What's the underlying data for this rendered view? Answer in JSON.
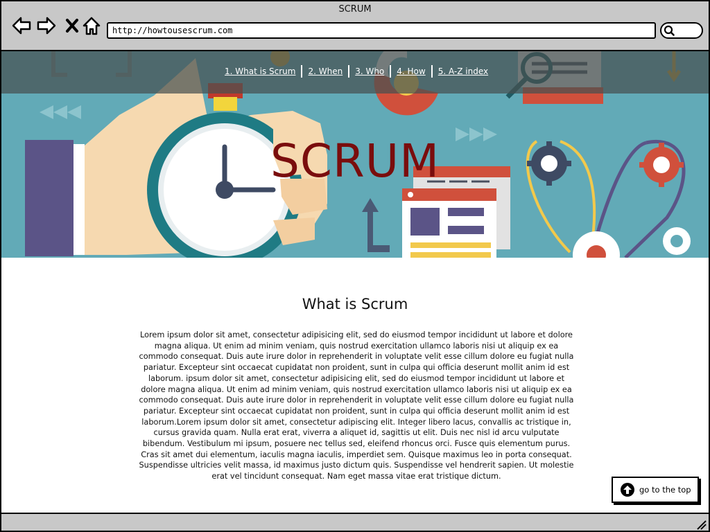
{
  "browser": {
    "window_title": "SCRUM",
    "url": "http://howtousescrum.com",
    "icons": {
      "back": "back-arrow-icon",
      "forward": "forward-arrow-icon",
      "stop": "close-icon",
      "home": "home-icon",
      "search": "search-icon",
      "resize": "resize-grip-icon"
    }
  },
  "nav": {
    "items": [
      {
        "label": "1. What is Scrum"
      },
      {
        "label": "2. When"
      },
      {
        "label": "3. Who"
      },
      {
        "label": "4. How"
      },
      {
        "label": "5. A-Z index"
      }
    ]
  },
  "hero": {
    "title": "SCRUM",
    "colors": {
      "background": "#62aab7",
      "title": "#7a0d0d",
      "overlay": "#465050"
    }
  },
  "content": {
    "heading": "What is Scrum",
    "body": "Lorem ipsum dolor sit amet, consectetur adipisicing elit, sed do eiusmod tempor incididunt ut labore et dolore magna aliqua. Ut enim ad minim veniam, quis nostrud exercitation ullamco laboris nisi ut aliquip ex ea commodo consequat. Duis aute irure dolor in reprehenderit in voluptate velit esse cillum dolore eu fugiat nulla pariatur. Excepteur sint occaecat cupidatat non proident, sunt in culpa qui officia deserunt mollit anim id est laborum. ipsum dolor sit amet, consectetur adipisicing elit, sed do eiusmod tempor incididunt ut labore et dolore magna aliqua. Ut enim ad minim veniam, quis nostrud exercitation ullamco laboris nisi ut aliquip ex ea commodo consequat. Duis aute irure dolor in reprehenderit in voluptate velit esse cillum dolore eu fugiat nulla pariatur. Excepteur sint occaecat cupidatat non proident, sunt in culpa qui officia deserunt mollit anim id est laborum.Lorem ipsum dolor sit amet, consectetur adipiscing elit. Integer libero lacus, convallis ac tristique in, cursus gravida quam. Nulla erat erat, viverra a aliquet id, sagittis ut elit. Duis nec nisl id arcu vulputate bibendum. Vestibulum mi ipsum, posuere nec tellus sed, eleifend rhoncus orci. Fusce quis elementum purus. Cras sit amet dui elementum, iaculis magna iaculis, imperdiet sem. Quisque maximus leo in porta consequat. Suspendisse ultricies velit massa, id maximus justo dictum quis. Suspendisse vel hendrerit sapien. Ut molestie erat vel tincidunt consequat. Nam eget massa vitae erat tristique dictum."
  },
  "go_top": {
    "label": "go to the top",
    "icon": "arrow-up-circle-icon"
  }
}
